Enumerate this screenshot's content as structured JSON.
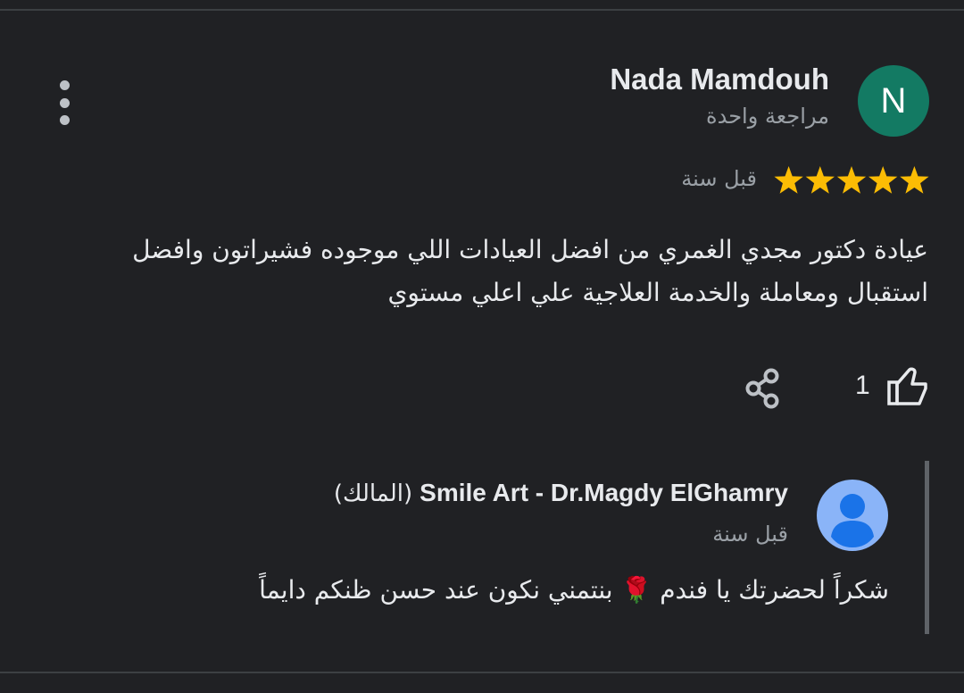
{
  "review": {
    "reviewer": {
      "name": "Nada Mamdouh",
      "initial": "N",
      "avatar_color": "#137a63",
      "subtitle": "مراجعة واحدة"
    },
    "rating": 5,
    "max_rating": 5,
    "star_color": "#fbbc04",
    "date": "قبل سنة",
    "text": "عيادة دكتور مجدي الغمري من افضل العيادات اللي موجوده فشيراتون وافضل استقبال ومعاملة والخدمة العلاجية علي اعلي مستوي",
    "likes": "1",
    "icons": {
      "more": "more-vert-icon",
      "share": "share-icon",
      "like": "thumb-up-icon"
    }
  },
  "owner_reply": {
    "name": "Smile Art - Dr.Magdy ElGhamry",
    "owner_tag": "(المالك)",
    "date": "قبل سنة",
    "text": "شكراً لحضرتك يا فندم 🌹 بنتمني نكون عند حسن ظنكم دايماً",
    "avatar_icon": "person-avatar-icon",
    "avatar_color": "#8ab4f8"
  }
}
